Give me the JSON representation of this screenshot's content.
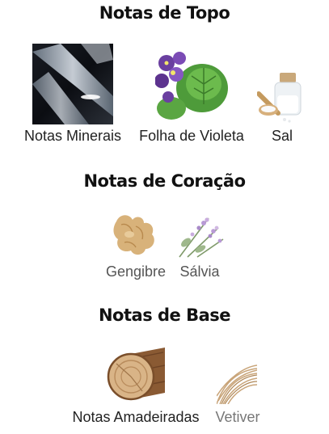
{
  "sections": [
    {
      "title": "Notas de Topo",
      "notes": [
        {
          "label": "Notas Minerais",
          "icon": "minerals-image"
        },
        {
          "label": "Folha de Violeta",
          "icon": "violet-leaf-image"
        },
        {
          "label": "Sal",
          "icon": "salt-image"
        }
      ]
    },
    {
      "title": "Notas de Coração",
      "notes": [
        {
          "label": "Gengibre",
          "icon": "ginger-image"
        },
        {
          "label": "Sálvia",
          "icon": "sage-image"
        }
      ]
    },
    {
      "title": "Notas de Base",
      "notes": [
        {
          "label": "Notas Amadeiradas",
          "icon": "wood-image"
        },
        {
          "label": "Vetiver",
          "icon": "vetiver-image"
        }
      ]
    }
  ]
}
